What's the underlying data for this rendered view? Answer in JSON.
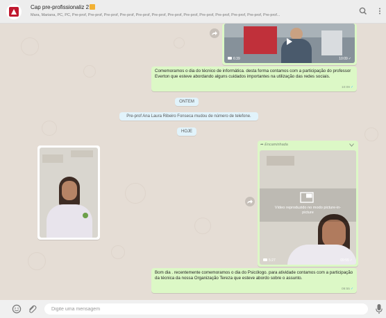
{
  "header": {
    "title": "Cap pre-profissionaliz 2",
    "members": "Mara, Mariana, PC, PC, Pre-prof, Pre-prof, Pre-prof, Pre-prof, Pre-prof, Pre-prof, Pre-prof, Pre-prof, Pre-prof, Pre-prof, Pre-prof, Pre-prof, Pre-prof...",
    "search_icon": "search-icon",
    "menu_icon": "menu-icon"
  },
  "messages": {
    "video1": {
      "duration": "6:39",
      "time": "10:09"
    },
    "text1": {
      "text": "Comemoramos o dia do técnico de informática. desta forma contamos com a participação do professor Everton que esteve abordando alguns cuidados importantes na utilização das redes sociais.",
      "time": "10:09"
    },
    "date_yesterday": "ONTEM",
    "system1": "Pre-prof Ana Laura Ribeiro Fonseca mudou de número de telefone.",
    "date_today": "HOJE",
    "video2": {
      "forwarded": "Encaminhada",
      "pip_text": "Vídeo reproduzido no modo picture-in-picture",
      "duration": "5:27",
      "time": "09:55"
    },
    "text2": {
      "text": "Bom dia . recentemente comemoramos o dia do Psicólogo. para atividade contamos com a participação da técnica da nossa Organização Tereza que esteve abordo sobre o assunto.",
      "time": "09:55"
    }
  },
  "footer": {
    "placeholder": "Digite uma mensagem",
    "emoji_icon": "emoji-icon",
    "attach_icon": "paperclip-icon",
    "mic_icon": "microphone-icon"
  },
  "colors": {
    "chat_bg": "#e5ddd5",
    "outgoing": "#dcf8c6",
    "system": "#e1f3fb",
    "header": "#ededed"
  }
}
